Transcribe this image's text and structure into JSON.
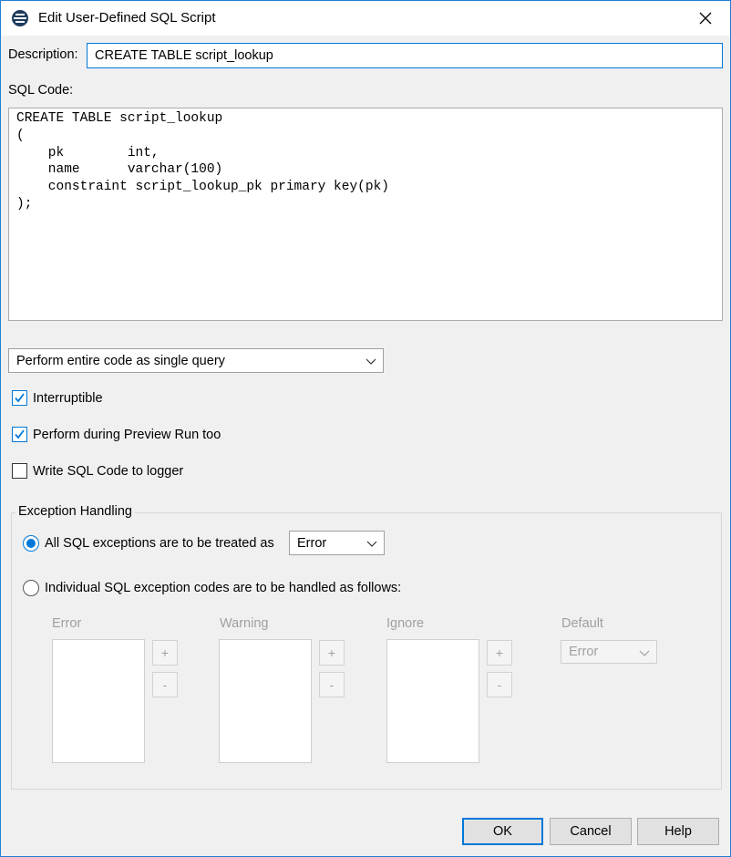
{
  "window": {
    "title": "Edit User-Defined SQL Script"
  },
  "description": {
    "label": "Description:",
    "value": "CREATE TABLE script_lookup"
  },
  "sql_code": {
    "label": "SQL Code:",
    "lines": [
      "CREATE TABLE script_lookup",
      "(",
      "    pk        int,",
      "    name      varchar(100)",
      "    constraint script_lookup_pk primary key(pk)",
      ");"
    ]
  },
  "execution_mode": {
    "selected": "Perform entire code as single query"
  },
  "options": {
    "interruptible": {
      "label": "Interruptible",
      "checked": true
    },
    "preview_run": {
      "label": "Perform during Preview Run too",
      "checked": true
    },
    "write_logger": {
      "label": "Write SQL Code to logger",
      "checked": false
    }
  },
  "exception_handling": {
    "title": "Exception Handling",
    "all_option": {
      "label": "All SQL exceptions are to be treated as",
      "selected": true,
      "value": "Error"
    },
    "individual_option": {
      "label": "Individual SQL exception codes are to be handled as follows:",
      "selected": false
    },
    "columns": {
      "error": "Error",
      "warning": "Warning",
      "ignore": "Ignore",
      "default": "Default"
    },
    "add_glyph": "+",
    "remove_glyph": "-",
    "default_value": "Error"
  },
  "buttons": {
    "ok": "OK",
    "cancel": "Cancel",
    "help": "Help"
  },
  "colors": {
    "accent": "#0078d7",
    "disabled_text": "#a0a0a0"
  }
}
